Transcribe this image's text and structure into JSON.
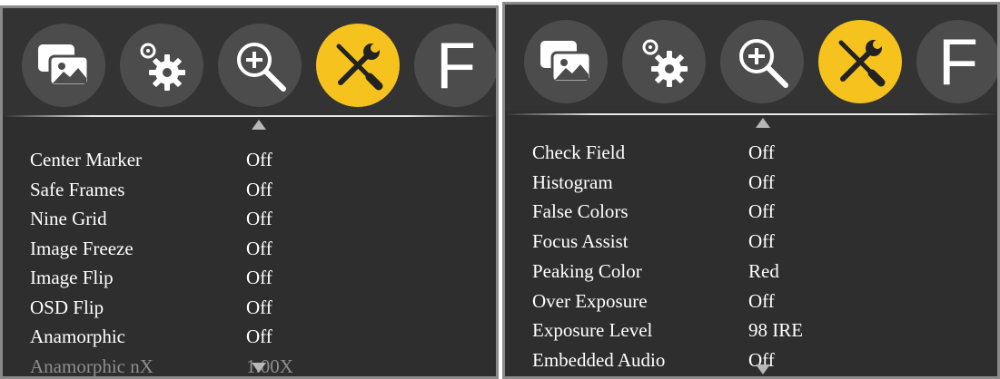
{
  "tabs": [
    {
      "icon": "image-icon",
      "label": ""
    },
    {
      "icon": "gear-icon",
      "label": ""
    },
    {
      "icon": "zoom-in-icon",
      "label": ""
    },
    {
      "icon": "tools-icon",
      "label": "",
      "active": true
    },
    {
      "icon": "function-icon",
      "label": "F"
    }
  ],
  "colors": {
    "panel_bg": "#2e2e2e",
    "tab_bg": "#4c4c4c",
    "tab_active": "#f6c21d",
    "text": "#ffffff",
    "text_disabled": "#8e8e8e"
  },
  "left_menu": {
    "items": [
      {
        "label": "Center Marker",
        "value": "Off"
      },
      {
        "label": "Safe Frames",
        "value": "Off"
      },
      {
        "label": "Nine Grid",
        "value": "Off"
      },
      {
        "label": "Image Freeze",
        "value": "Off"
      },
      {
        "label": "Image Flip",
        "value": "Off"
      },
      {
        "label": "OSD Flip",
        "value": "Off"
      },
      {
        "label": "Anamorphic",
        "value": "Off"
      },
      {
        "label": "Anamorphic nX",
        "value": "1.00X",
        "disabled": true
      }
    ]
  },
  "right_menu": {
    "items": [
      {
        "label": "Check Field",
        "value": "Off"
      },
      {
        "label": "Histogram",
        "value": "Off"
      },
      {
        "label": "False Colors",
        "value": "Off"
      },
      {
        "label": "Focus Assist",
        "value": "Off"
      },
      {
        "label": "Peaking Color",
        "value": "Red"
      },
      {
        "label": "Over Exposure",
        "value": "Off"
      },
      {
        "label": "Exposure Level",
        "value": "98 IRE"
      },
      {
        "label": "Embedded Audio",
        "value": "Off"
      }
    ]
  }
}
